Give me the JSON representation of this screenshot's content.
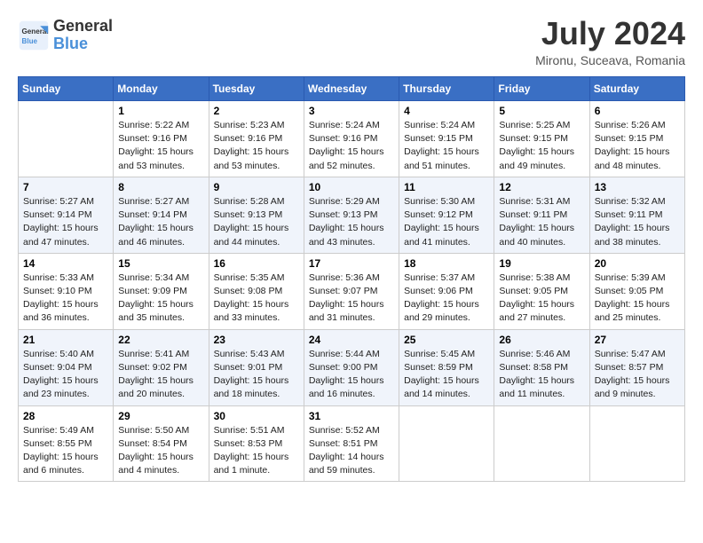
{
  "header": {
    "logo_line1": "General",
    "logo_line2": "Blue",
    "title": "July 2024",
    "location": "Mironu, Suceava, Romania"
  },
  "columns": [
    "Sunday",
    "Monday",
    "Tuesday",
    "Wednesday",
    "Thursday",
    "Friday",
    "Saturday"
  ],
  "weeks": [
    [
      {
        "day": "",
        "info": ""
      },
      {
        "day": "1",
        "info": "Sunrise: 5:22 AM\nSunset: 9:16 PM\nDaylight: 15 hours\nand 53 minutes."
      },
      {
        "day": "2",
        "info": "Sunrise: 5:23 AM\nSunset: 9:16 PM\nDaylight: 15 hours\nand 53 minutes."
      },
      {
        "day": "3",
        "info": "Sunrise: 5:24 AM\nSunset: 9:16 PM\nDaylight: 15 hours\nand 52 minutes."
      },
      {
        "day": "4",
        "info": "Sunrise: 5:24 AM\nSunset: 9:15 PM\nDaylight: 15 hours\nand 51 minutes."
      },
      {
        "day": "5",
        "info": "Sunrise: 5:25 AM\nSunset: 9:15 PM\nDaylight: 15 hours\nand 49 minutes."
      },
      {
        "day": "6",
        "info": "Sunrise: 5:26 AM\nSunset: 9:15 PM\nDaylight: 15 hours\nand 48 minutes."
      }
    ],
    [
      {
        "day": "7",
        "info": "Sunrise: 5:27 AM\nSunset: 9:14 PM\nDaylight: 15 hours\nand 47 minutes."
      },
      {
        "day": "8",
        "info": "Sunrise: 5:27 AM\nSunset: 9:14 PM\nDaylight: 15 hours\nand 46 minutes."
      },
      {
        "day": "9",
        "info": "Sunrise: 5:28 AM\nSunset: 9:13 PM\nDaylight: 15 hours\nand 44 minutes."
      },
      {
        "day": "10",
        "info": "Sunrise: 5:29 AM\nSunset: 9:13 PM\nDaylight: 15 hours\nand 43 minutes."
      },
      {
        "day": "11",
        "info": "Sunrise: 5:30 AM\nSunset: 9:12 PM\nDaylight: 15 hours\nand 41 minutes."
      },
      {
        "day": "12",
        "info": "Sunrise: 5:31 AM\nSunset: 9:11 PM\nDaylight: 15 hours\nand 40 minutes."
      },
      {
        "day": "13",
        "info": "Sunrise: 5:32 AM\nSunset: 9:11 PM\nDaylight: 15 hours\nand 38 minutes."
      }
    ],
    [
      {
        "day": "14",
        "info": "Sunrise: 5:33 AM\nSunset: 9:10 PM\nDaylight: 15 hours\nand 36 minutes."
      },
      {
        "day": "15",
        "info": "Sunrise: 5:34 AM\nSunset: 9:09 PM\nDaylight: 15 hours\nand 35 minutes."
      },
      {
        "day": "16",
        "info": "Sunrise: 5:35 AM\nSunset: 9:08 PM\nDaylight: 15 hours\nand 33 minutes."
      },
      {
        "day": "17",
        "info": "Sunrise: 5:36 AM\nSunset: 9:07 PM\nDaylight: 15 hours\nand 31 minutes."
      },
      {
        "day": "18",
        "info": "Sunrise: 5:37 AM\nSunset: 9:06 PM\nDaylight: 15 hours\nand 29 minutes."
      },
      {
        "day": "19",
        "info": "Sunrise: 5:38 AM\nSunset: 9:05 PM\nDaylight: 15 hours\nand 27 minutes."
      },
      {
        "day": "20",
        "info": "Sunrise: 5:39 AM\nSunset: 9:05 PM\nDaylight: 15 hours\nand 25 minutes."
      }
    ],
    [
      {
        "day": "21",
        "info": "Sunrise: 5:40 AM\nSunset: 9:04 PM\nDaylight: 15 hours\nand 23 minutes."
      },
      {
        "day": "22",
        "info": "Sunrise: 5:41 AM\nSunset: 9:02 PM\nDaylight: 15 hours\nand 20 minutes."
      },
      {
        "day": "23",
        "info": "Sunrise: 5:43 AM\nSunset: 9:01 PM\nDaylight: 15 hours\nand 18 minutes."
      },
      {
        "day": "24",
        "info": "Sunrise: 5:44 AM\nSunset: 9:00 PM\nDaylight: 15 hours\nand 16 minutes."
      },
      {
        "day": "25",
        "info": "Sunrise: 5:45 AM\nSunset: 8:59 PM\nDaylight: 15 hours\nand 14 minutes."
      },
      {
        "day": "26",
        "info": "Sunrise: 5:46 AM\nSunset: 8:58 PM\nDaylight: 15 hours\nand 11 minutes."
      },
      {
        "day": "27",
        "info": "Sunrise: 5:47 AM\nSunset: 8:57 PM\nDaylight: 15 hours\nand 9 minutes."
      }
    ],
    [
      {
        "day": "28",
        "info": "Sunrise: 5:49 AM\nSunset: 8:55 PM\nDaylight: 15 hours\nand 6 minutes."
      },
      {
        "day": "29",
        "info": "Sunrise: 5:50 AM\nSunset: 8:54 PM\nDaylight: 15 hours\nand 4 minutes."
      },
      {
        "day": "30",
        "info": "Sunrise: 5:51 AM\nSunset: 8:53 PM\nDaylight: 15 hours\nand 1 minute."
      },
      {
        "day": "31",
        "info": "Sunrise: 5:52 AM\nSunset: 8:51 PM\nDaylight: 14 hours\nand 59 minutes."
      },
      {
        "day": "",
        "info": ""
      },
      {
        "day": "",
        "info": ""
      },
      {
        "day": "",
        "info": ""
      }
    ]
  ]
}
